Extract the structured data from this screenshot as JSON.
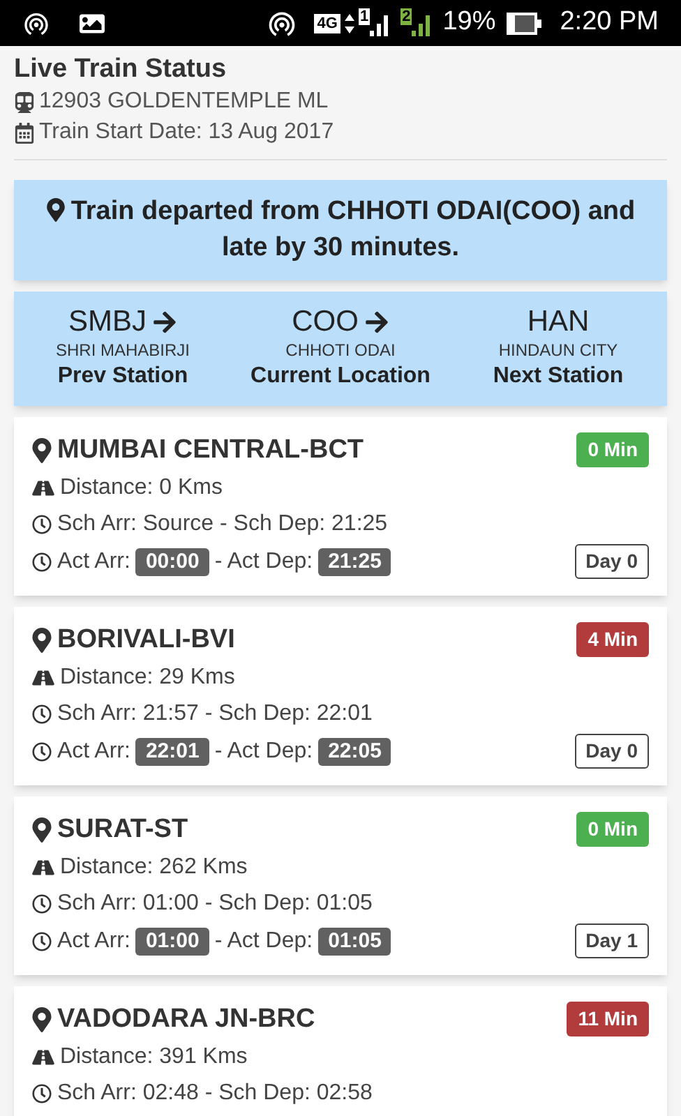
{
  "status_bar": {
    "network": "4G",
    "sim_1": "1",
    "sim_2": "2",
    "battery": "19%",
    "time": "2:20 PM"
  },
  "header": {
    "title": "Live Train Status",
    "train": "12903 GOLDENTEMPLE ML",
    "start_date": "Train Start Date: 13 Aug 2017"
  },
  "alert": "Train departed from CHHOTI ODAI(COO) and late by 30 minutes.",
  "route": [
    {
      "code": "SMBJ",
      "name": "SHRI MAHABIRJI",
      "label": "Prev Station",
      "arrow": true
    },
    {
      "code": "COO",
      "name": "CHHOTI ODAI",
      "label": "Current Location",
      "arrow": true
    },
    {
      "code": "HAN",
      "name": "HINDAUN CITY",
      "label": "Next Station",
      "arrow": false
    }
  ],
  "stations": [
    {
      "name": "MUMBAI CENTRAL-BCT",
      "delay": "0 Min",
      "color": "#4caf50",
      "distance": "Distance: 0 Kms",
      "schedule": "Sch Arr: Source - Sch Dep: 21:25",
      "act_arr_label": "Act Arr:",
      "act_arr": "00:00",
      "act_dep_label": "- Act Dep:",
      "act_dep": "21:25",
      "day": "Day 0"
    },
    {
      "name": "BORIVALI-BVI",
      "delay": "4 Min",
      "color": "#b23b3b",
      "distance": "Distance: 29 Kms",
      "schedule": "Sch Arr: 21:57 - Sch Dep: 22:01",
      "act_arr_label": "Act Arr:",
      "act_arr": "22:01",
      "act_dep_label": "- Act Dep:",
      "act_dep": "22:05",
      "day": "Day 0"
    },
    {
      "name": "SURAT-ST",
      "delay": "0 Min",
      "color": "#4caf50",
      "distance": "Distance: 262 Kms",
      "schedule": "Sch Arr: 01:00 - Sch Dep: 01:05",
      "act_arr_label": "Act Arr:",
      "act_arr": "01:00",
      "act_dep_label": "- Act Dep:",
      "act_dep": "01:05",
      "day": "Day 1"
    },
    {
      "name": "VADODARA JN-BRC",
      "delay": "11 Min",
      "color": "#b23b3b",
      "distance": "Distance: 391 Kms",
      "schedule": "Sch Arr: 02:48 - Sch Dep: 02:58"
    }
  ]
}
